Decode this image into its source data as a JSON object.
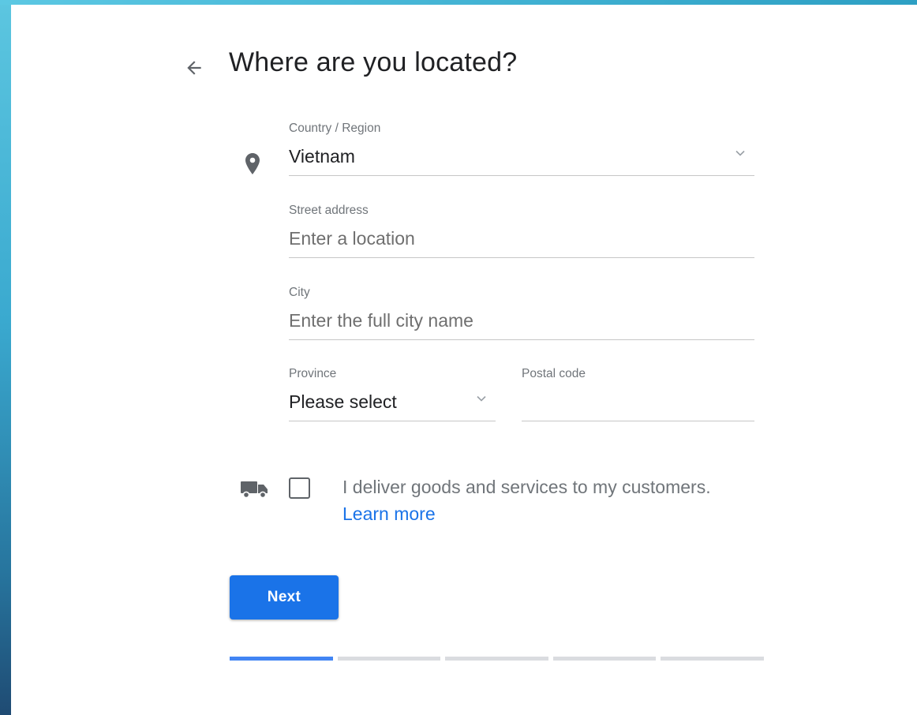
{
  "page": {
    "title": "Where are you located?",
    "back_icon": "arrow-back-icon"
  },
  "form": {
    "country": {
      "label": "Country / Region",
      "value": "Vietnam",
      "icon": "location-pin-icon"
    },
    "street": {
      "label": "Street address",
      "placeholder": "Enter a location"
    },
    "city": {
      "label": "City",
      "placeholder": "Enter the full city name"
    },
    "province": {
      "label": "Province",
      "value": "Please select"
    },
    "postal": {
      "label": "Postal code",
      "value": ""
    }
  },
  "delivery": {
    "icon": "truck-icon",
    "checked": false,
    "text": "I deliver goods and services to my customers.",
    "learn_more": "Learn more"
  },
  "actions": {
    "next_label": "Next"
  },
  "progress": {
    "steps_total": 5,
    "current_step": 1
  },
  "colors": {
    "accent": "#1a73e8",
    "progress_active": "#4285f4",
    "progress_inactive": "#dadce0"
  }
}
